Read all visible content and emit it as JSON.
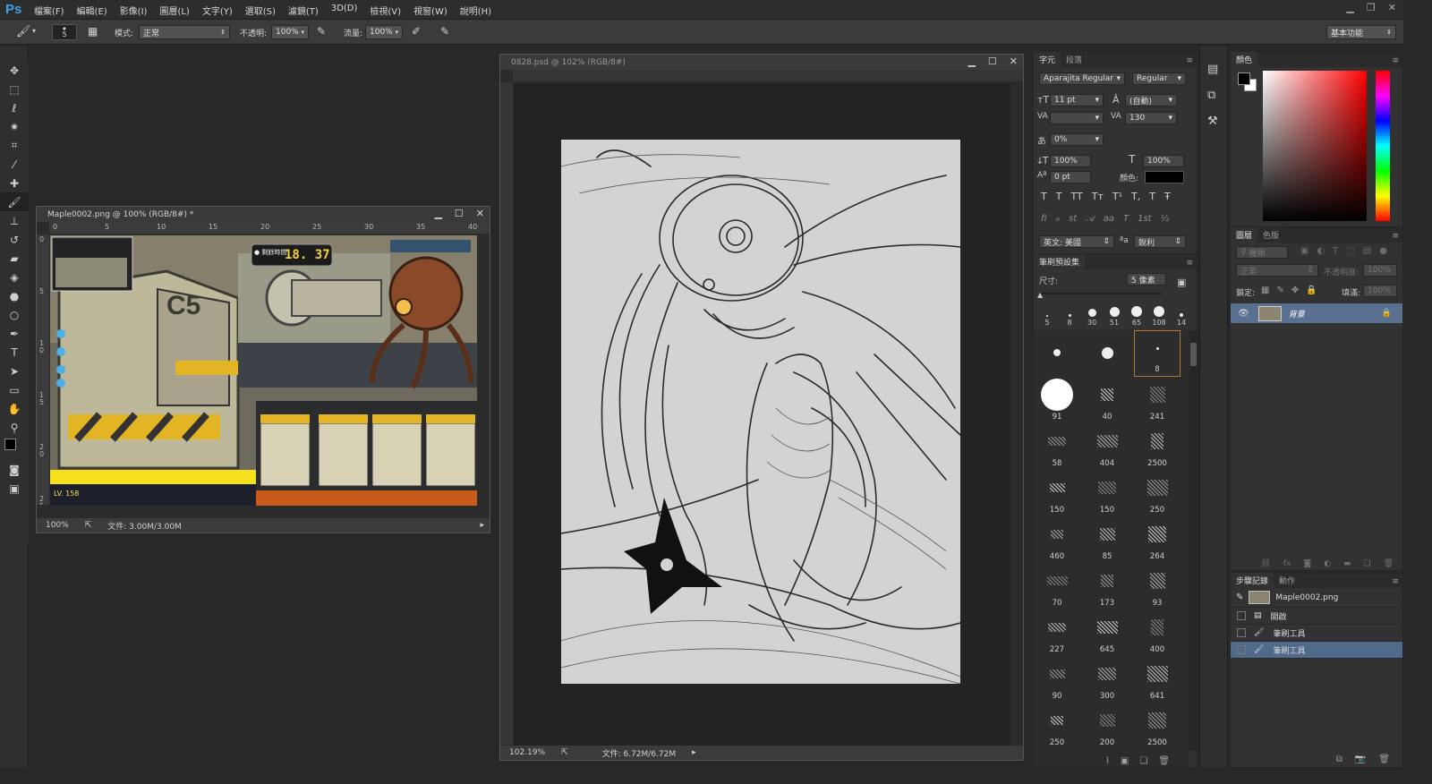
{
  "app": {
    "logo": "Ps"
  },
  "menu": [
    "檔案(F)",
    "編輯(E)",
    "影像(I)",
    "圖層(L)",
    "文字(Y)",
    "選取(S)",
    "濾鏡(T)",
    "3D(D)",
    "檢視(V)",
    "視窗(W)",
    "說明(H)"
  ],
  "options": {
    "brush_size": "5",
    "mode_label": "模式:",
    "mode_value": "正常",
    "opacity_label": "不透明:",
    "opacity_value": "100%",
    "flow_label": "流量:",
    "flow_value": "100%",
    "workspace": "基本功能"
  },
  "doc1": {
    "title": "Maple0002.png @ 100% (RGB/8#) *",
    "ruler_h": [
      "0",
      "5",
      "10",
      "15",
      "20",
      "25",
      "30",
      "35",
      "40"
    ],
    "ruler_v": [
      "0",
      "5",
      "1\n0",
      "1\n5",
      "2\n0",
      "2\n5"
    ],
    "zoom": "100%",
    "file_info": "文件: 3.00M/3.00M",
    "game": {
      "timer_label": "● 剩餘時間",
      "timer": "18. 37",
      "level": "LV. 158",
      "sign": "C5"
    }
  },
  "doc2": {
    "title": "0828.psd @ 102% (RGB/8#)",
    "zoom": "102.19%",
    "file_info": "文件: 6.72M/6.72M"
  },
  "char_panel": {
    "tabs": [
      "字元",
      "段落"
    ],
    "font": "Aparajita Regular",
    "style": "Regular",
    "size": "11 pt",
    "leading": "(自動)",
    "kerning": "",
    "tracking": "130",
    "scale_pct": "0%",
    "vscale": "100%",
    "hscale": "100%",
    "baseline": "0 pt",
    "color_label": "顏色:",
    "language": "英文: 美國",
    "antialias": "銳利",
    "style_buttons": [
      "T",
      "T",
      "TT",
      "Tт",
      "T¹",
      "T,",
      "T",
      "Ŧ"
    ],
    "ot_buttons": [
      "fi",
      "ℴ",
      "st",
      "𝒜",
      "aa",
      "T",
      "1st",
      "½"
    ]
  },
  "brush_panel": {
    "tab": "筆刷預設集",
    "size_label": "尺寸:",
    "size_value": "5 像素",
    "recent": [
      "5",
      "8",
      "30",
      "51",
      "65",
      "108",
      "14"
    ],
    "grid": [
      "",
      "",
      "8",
      "91",
      "40",
      "241",
      "58",
      "404",
      "2500",
      "150",
      "150",
      "250",
      "460",
      "85",
      "264",
      "70",
      "173",
      "93",
      "227",
      "645",
      "400",
      "90",
      "300",
      "641",
      "250",
      "200",
      "2500"
    ]
  },
  "color_panel": {
    "tabs": [
      "顏色",
      ""
    ],
    "fg": "#000000",
    "bg": "#ffffff"
  },
  "layers_panel": {
    "tabs": [
      "圖層",
      "色版"
    ],
    "kind": "種類",
    "blend": "正常",
    "opacity_label": "不透明度:",
    "opacity_value": "100%",
    "lock_label": "鎖定:",
    "fill_label": "填滿:",
    "fill_value": "100%",
    "layer_name": "背景"
  },
  "history_panel": {
    "tabs": [
      "步驟記錄",
      "動作"
    ],
    "snapshot": "Maple0002.png",
    "items": [
      "開啟",
      "筆刷工具",
      "筆刷工具"
    ]
  }
}
